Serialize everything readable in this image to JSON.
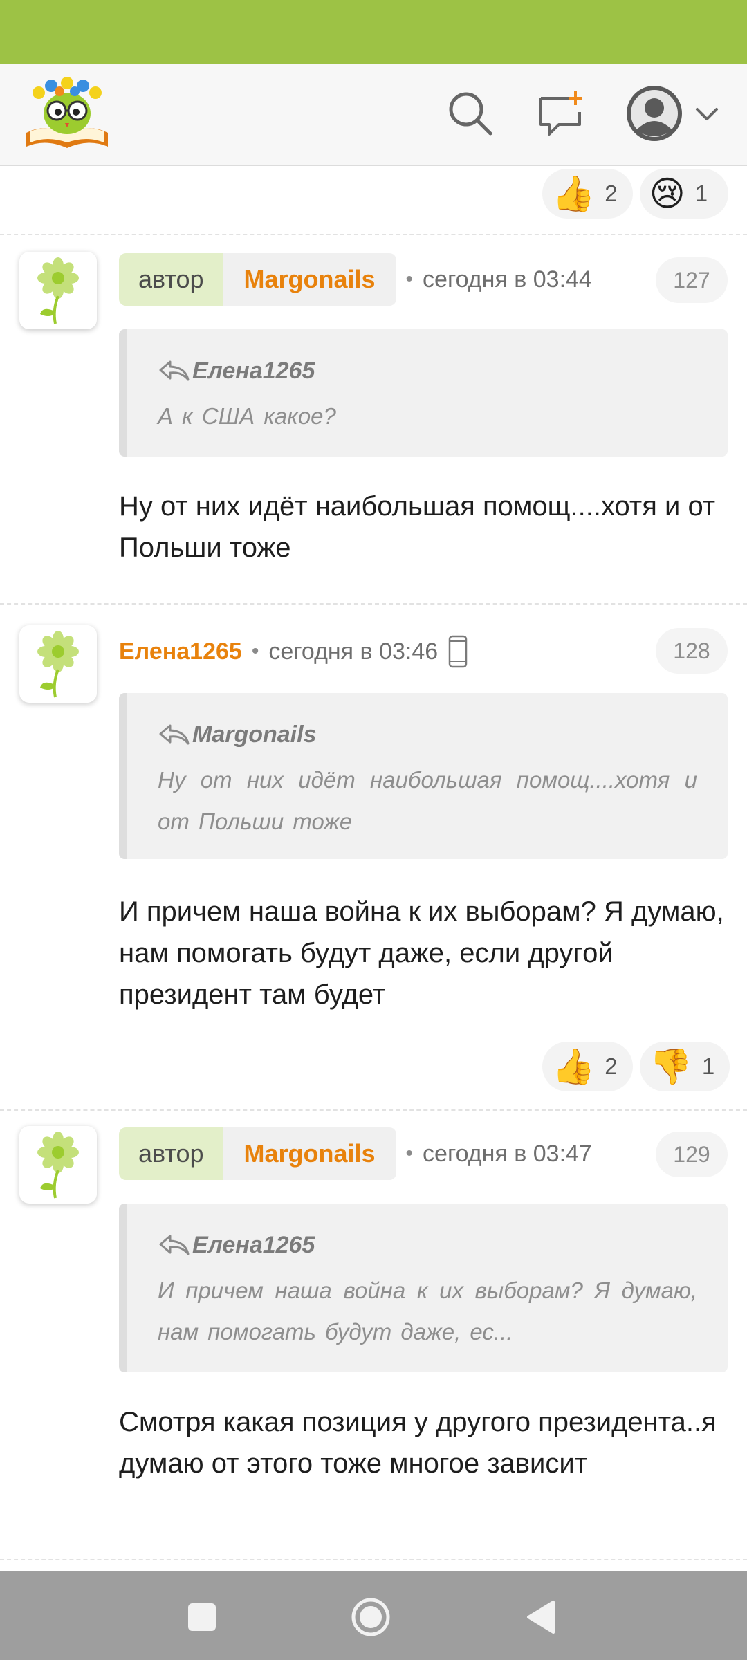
{
  "header": {
    "logo": "book-mascot-logo",
    "icons": [
      "search-icon",
      "new-message-icon",
      "user-avatar-icon",
      "chevron-down-icon"
    ]
  },
  "top_reactions": [
    {
      "emoji": "👍",
      "count": "2"
    },
    {
      "emoji": "😢",
      "count": "1"
    }
  ],
  "comments": [
    {
      "author_tag": "автор",
      "author": "Margonails",
      "time": "сегодня в 03:44",
      "number": "127",
      "quote_author": "Елена1265",
      "quote_text": "А к США какое?",
      "text": "Ну от них идёт наибольшая помощ....хотя и от Польши тоже"
    },
    {
      "author": "Елена1265",
      "time": "сегодня в 03:46",
      "number": "128",
      "quote_author": "Margonails",
      "quote_text": "Ну от них идёт наибольшая помощ....хотя и от Польши тоже",
      "text": "И причем наша война к их выборам? Я думаю, нам помогать будут даже, если другой президент там будет",
      "reactions": [
        {
          "emoji": "👍",
          "count": "2"
        },
        {
          "emoji": "👎",
          "count": "1"
        }
      ]
    },
    {
      "author_tag": "автор",
      "author": "Margonails",
      "time": "сегодня в 03:47",
      "number": "129",
      "quote_author": "Елена1265",
      "quote_text": "И причем наша война к их выборам? Я думаю, нам помогать будут даже, ес...",
      "text": "Смотря какая позиция у другого президента..я думаю от этого тоже многое зависит"
    }
  ],
  "colors": {
    "status_bar": "#9dc245",
    "accent_orange": "#e8820c",
    "author_tag_bg": "#e3efc9",
    "nav_bar": "#9e9e9e"
  }
}
